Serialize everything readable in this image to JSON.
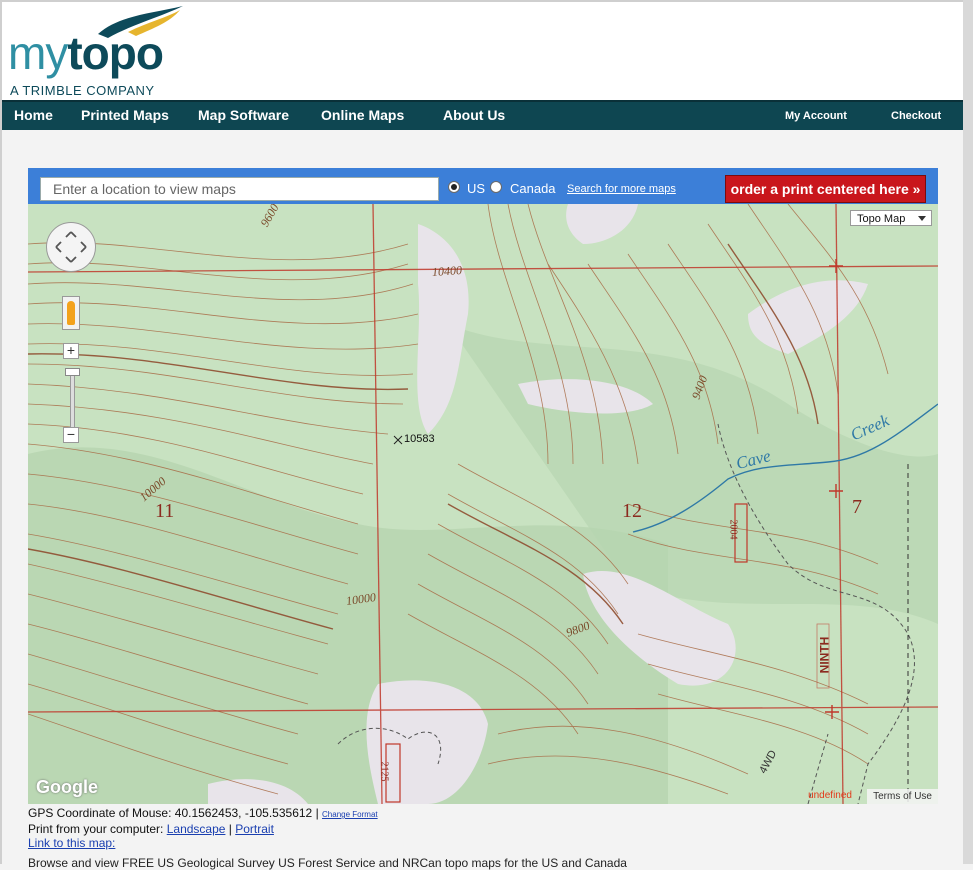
{
  "brand": {
    "logo_my": "my",
    "logo_topo": "topo",
    "tagline": "A TRIMBLE COMPANY"
  },
  "nav": {
    "items": [
      "Home",
      "Printed Maps",
      "Map Software",
      "Online Maps",
      "About Us"
    ],
    "account": "My Account",
    "checkout": "Checkout"
  },
  "search": {
    "placeholder": "Enter a location to view maps",
    "option_us": "US",
    "option_canada": "Canada",
    "selected": "US",
    "more_link": "Search for more maps",
    "order_button": "order a print centered here »"
  },
  "map": {
    "type_selector": "Topo Map",
    "zoom_in": "+",
    "zoom_out": "−",
    "attribution": "Google",
    "terms": "Terms of Use",
    "status": "undefined",
    "section_labels": [
      "11",
      "12",
      "7"
    ],
    "elevation_labels": [
      "9600",
      "10400",
      "10583",
      "10000",
      "10000",
      "9800",
      "9400"
    ],
    "feature_labels": [
      "Cave",
      "Creek",
      "NINTH",
      "4WD",
      "2004",
      "2125"
    ],
    "colors": {
      "terrain": "#c8e2c1",
      "contour": "#a86a45",
      "grid": "#c0372a",
      "stream": "#2f79a6",
      "clearing": "#e8e4ea"
    }
  },
  "info": {
    "gps_label": "GPS Coordinate of Mouse:",
    "gps_value": "40.1562453, -105.535612",
    "change_format": "Change Format",
    "print_label": "Print from your computer:",
    "landscape": "Landscape",
    "portrait": "Portrait",
    "link": "Link to this map:",
    "footer_text": "Browse and view FREE US Geological Survey US Forest Service and NRCan topo maps for the US and Canada"
  }
}
